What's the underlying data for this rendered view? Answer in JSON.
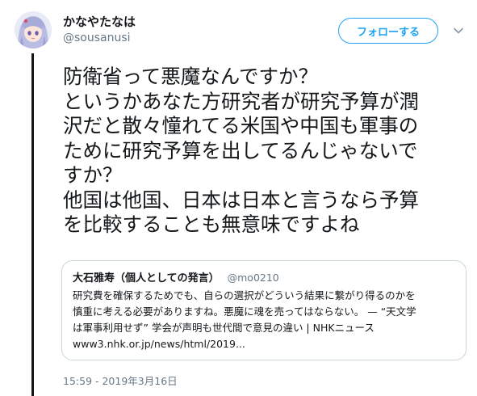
{
  "user": {
    "display_name": "かなやたなは",
    "username": "@sousanusi",
    "avatar_icon": "anime-avatar"
  },
  "actions": {
    "follow_label": "フォローする",
    "menu_icon": "chevron-down-icon",
    "accent_color": "#1da1f2"
  },
  "tweet": {
    "lines": [
      "防衛省って悪魔なんですか？",
      "というかあなた方研究者が研究予算が潤",
      "沢だと散々憧れてる米国や中国も軍事の",
      "ために研究予算を出してるんじゃないで",
      "すか？",
      "他国は他国、日本は日本と言うなら予算",
      "を比較することも無意味ですよね"
    ]
  },
  "quoted_tweet": {
    "name": "大石雅寿（個人としての発言）",
    "handle": "@mo0210",
    "lines": [
      "研究費を確保するためでも、自らの選択がどういう結果に繋がり得るのかを",
      "慎重に考える必要がありますね。悪魔に魂を売ってはならない。 — “天文学",
      "は軍事利用せず” 学会が声明も世代間で意見の違い | NHKニュース",
      "www3.nhk.or.jp/news/html/2019..."
    ]
  },
  "timestamp": "15:59 - 2019年3月16日"
}
